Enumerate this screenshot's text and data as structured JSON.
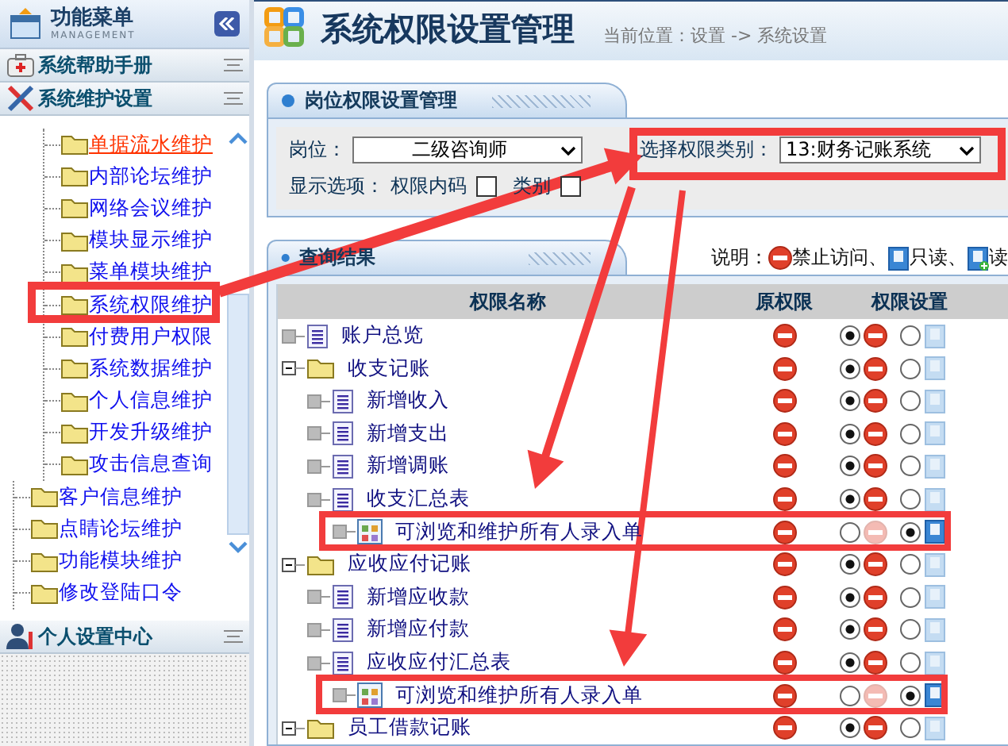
{
  "sidebar": {
    "title": "功能菜单",
    "subtitle": "MANAGEMENT",
    "sections": [
      {
        "kind": "help",
        "title": "系统帮助手册"
      },
      {
        "kind": "tools",
        "title": "系统维护设置"
      }
    ],
    "nested_items": [
      {
        "label": "单据流水维护",
        "selected": true
      },
      {
        "label": "内部论坛维护",
        "selected": false
      },
      {
        "label": "网络会议维护",
        "selected": false
      },
      {
        "label": "模块显示维护",
        "selected": false
      },
      {
        "label": "菜单模块维护",
        "selected": false
      },
      {
        "label": "系统权限维护",
        "selected": false
      },
      {
        "label": "付费用户权限",
        "selected": false
      },
      {
        "label": "系统数据维护",
        "selected": false
      },
      {
        "label": "个人信息维护",
        "selected": false
      },
      {
        "label": "开发升级维护",
        "selected": false
      },
      {
        "label": "攻击信息查询",
        "selected": false
      }
    ],
    "items": [
      {
        "label": "客户信息维护",
        "selected": false
      },
      {
        "label": "点睛论坛维护",
        "selected": false
      },
      {
        "label": "功能模块维护",
        "selected": false
      },
      {
        "label": "修改登陆口令",
        "selected": false
      }
    ],
    "footer_section": {
      "kind": "user",
      "title": "个人设置中心"
    }
  },
  "header": {
    "title": "系统权限设置管理",
    "breadcrumb": "当前位置：设置 -> 系统设置"
  },
  "settings_panel": {
    "title": "岗位权限设置管理",
    "position_label": "岗位：",
    "position_value": "二级咨询师",
    "category_label": "选择权限类别：",
    "category_value": "13:财务记账系统",
    "options_label": "显示选项：",
    "options": [
      {
        "label": "权限内码",
        "checked": false
      },
      {
        "label": "类别",
        "checked": false
      }
    ]
  },
  "results_panel": {
    "title": "查询结果",
    "legend_label": "说明：",
    "legend": [
      {
        "kind": "forbid",
        "label": "禁止访问、"
      },
      {
        "kind": "read",
        "label": "只读、"
      },
      {
        "kind": "readwrite",
        "label": "读"
      }
    ],
    "columns": [
      "权限名称",
      "原权限",
      "权限设置"
    ],
    "rows": [
      {
        "kind": "page",
        "label": "账户总览",
        "original": {
          "kind": "forbid"
        },
        "settings": [
          {
            "kind": "forbid",
            "selected": true
          },
          {
            "kind": "read",
            "selected": false
          }
        ]
      },
      {
        "kind": "folder",
        "label": "收支记账",
        "expanded": true,
        "original": {
          "kind": "forbid"
        },
        "settings": [
          {
            "kind": "forbid",
            "selected": true
          },
          {
            "kind": "read",
            "selected": false
          }
        ],
        "children": [
          {
            "kind": "page",
            "label": "新增收入",
            "original": {
              "kind": "forbid"
            },
            "settings": [
              {
                "kind": "forbid",
                "selected": true
              },
              {
                "kind": "read",
                "selected": false
              }
            ]
          },
          {
            "kind": "page",
            "label": "新增支出",
            "original": {
              "kind": "forbid"
            },
            "settings": [
              {
                "kind": "forbid",
                "selected": true
              },
              {
                "kind": "read",
                "selected": false
              }
            ]
          },
          {
            "kind": "page",
            "label": "新增调账",
            "original": {
              "kind": "forbid"
            },
            "settings": [
              {
                "kind": "forbid",
                "selected": true
              },
              {
                "kind": "read",
                "selected": false
              }
            ]
          },
          {
            "kind": "page",
            "label": "收支汇总表",
            "original": {
              "kind": "forbid"
            },
            "settings": [
              {
                "kind": "forbid",
                "selected": true
              },
              {
                "kind": "read",
                "selected": false
              }
            ],
            "children": [
              {
                "kind": "permission",
                "label": "可浏览和维护所有人录入单",
                "original": {
                  "kind": "forbid"
                },
                "settings": [
                  {
                    "kind": "forbid",
                    "selected": false
                  },
                  {
                    "kind": "read",
                    "selected": true
                  }
                ]
              }
            ]
          }
        ]
      },
      {
        "kind": "folder",
        "label": "应收应付记账",
        "expanded": true,
        "original": {
          "kind": "forbid"
        },
        "settings": [
          {
            "kind": "forbid",
            "selected": true
          },
          {
            "kind": "read",
            "selected": false
          }
        ],
        "children": [
          {
            "kind": "page",
            "label": "新增应收款",
            "original": {
              "kind": "forbid"
            },
            "settings": [
              {
                "kind": "forbid",
                "selected": true
              },
              {
                "kind": "read",
                "selected": false
              }
            ]
          },
          {
            "kind": "page",
            "label": "新增应付款",
            "original": {
              "kind": "forbid"
            },
            "settings": [
              {
                "kind": "forbid",
                "selected": true
              },
              {
                "kind": "read",
                "selected": false
              }
            ]
          },
          {
            "kind": "page",
            "label": "应收应付汇总表",
            "original": {
              "kind": "forbid"
            },
            "settings": [
              {
                "kind": "forbid",
                "selected": true
              },
              {
                "kind": "read",
                "selected": false
              }
            ],
            "children": [
              {
                "kind": "permission",
                "label": "可浏览和维护所有人录入单",
                "original": {
                  "kind": "forbid"
                },
                "settings": [
                  {
                    "kind": "forbid",
                    "selected": false
                  },
                  {
                    "kind": "read",
                    "selected": true
                  }
                ]
              }
            ]
          }
        ]
      },
      {
        "kind": "folder",
        "label": "员工借款记账",
        "expanded": true,
        "original": {
          "kind": "forbid"
        },
        "settings": [
          {
            "kind": "forbid",
            "selected": true
          },
          {
            "kind": "read",
            "selected": false
          }
        ]
      }
    ]
  }
}
